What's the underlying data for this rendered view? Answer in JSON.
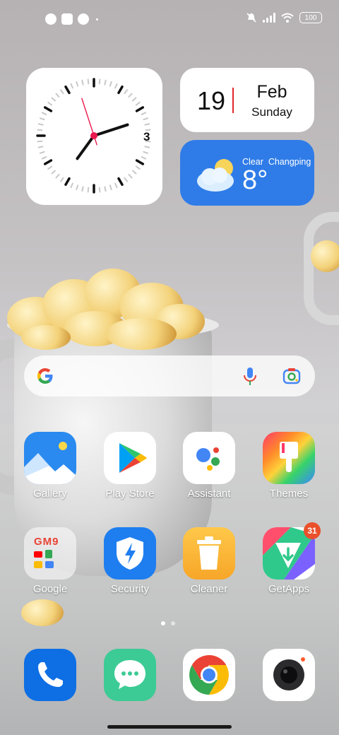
{
  "status_bar": {
    "left_icons": [
      "notification-app-icon",
      "notification-square-icon",
      "notification-app-icon"
    ],
    "right_icons": [
      "mute-icon",
      "signal-icon",
      "wifi-icon"
    ],
    "battery": "100"
  },
  "clock_widget": {
    "numeral": "3",
    "hour": 7.2,
    "minute": 12,
    "second": 27
  },
  "calendar_widget": {
    "day": "19",
    "month": "Feb",
    "weekday": "Sunday"
  },
  "weather_widget": {
    "condition": "Clear",
    "location": "Changping",
    "temperature": "8°",
    "icon": "partly-cloudy-icon"
  },
  "search_bar": {
    "icons": [
      "google-logo-icon",
      "microphone-icon",
      "lens-camera-icon"
    ]
  },
  "apps": [
    {
      "label": "Gallery"
    },
    {
      "label": "Play Store"
    },
    {
      "label": "Assistant"
    },
    {
      "label": "Themes"
    },
    {
      "label": "Google",
      "folder_text": "GM9"
    },
    {
      "label": "Security"
    },
    {
      "label": "Cleaner"
    },
    {
      "label": "GetApps",
      "badge": "31"
    }
  ],
  "dock": [
    {
      "icon": "phone-icon"
    },
    {
      "icon": "messages-icon"
    },
    {
      "icon": "chrome-icon"
    },
    {
      "icon": "camera-icon"
    }
  ],
  "page_indicator": {
    "pages": 2,
    "current": 1
  },
  "colors": {
    "weather_bg": "#2f7ce8",
    "calendar_accent": "#e0272a",
    "badge": "#e9502b"
  }
}
